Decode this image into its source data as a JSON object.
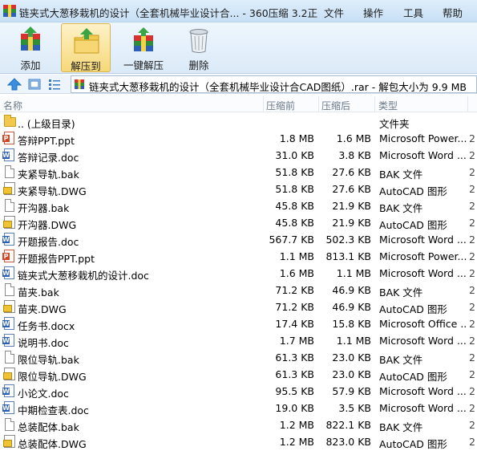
{
  "window": {
    "title": "链夹式大葱移栽机的设计（全套机械毕业设计合... - 360压缩 3.2正式版",
    "menu": [
      "文件",
      "操作",
      "工具",
      "帮助"
    ]
  },
  "toolbar": {
    "buttons": [
      {
        "label": "添加",
        "icon": "add-archive-icon"
      },
      {
        "label": "解压到",
        "icon": "extract-to-icon"
      },
      {
        "label": "一键解压",
        "icon": "one-click-extract-icon"
      },
      {
        "label": "删除",
        "icon": "trash-icon"
      }
    ]
  },
  "address": {
    "text": "链夹式大葱移栽机的设计（全套机械毕业设计合CAD图纸）.rar - 解包大小为 9.9 MB"
  },
  "columns": {
    "name": "名称",
    "size": "压缩前",
    "packed": "压缩后",
    "type": "类型"
  },
  "files": [
    {
      "name": ".. (上级目录)",
      "size": "",
      "packed": "",
      "type": "文件夹",
      "icon": "folder-icon"
    },
    {
      "name": "答辩PPT.ppt",
      "size": "1.8 MB",
      "packed": "1.6 MB",
      "type": "Microsoft Power...",
      "icon": "ppt-icon"
    },
    {
      "name": "答辩记录.doc",
      "size": "31.0 KB",
      "packed": "3.8 KB",
      "type": "Microsoft Word ...",
      "icon": "word-icon"
    },
    {
      "name": "夹紧导轨.bak",
      "size": "51.8 KB",
      "packed": "27.6 KB",
      "type": "BAK 文件",
      "icon": "bak-icon"
    },
    {
      "name": "夹紧导轨.DWG",
      "size": "51.8 KB",
      "packed": "27.6 KB",
      "type": "AutoCAD 图形",
      "icon": "dwg-icon"
    },
    {
      "name": "开沟器.bak",
      "size": "45.8 KB",
      "packed": "21.9 KB",
      "type": "BAK 文件",
      "icon": "bak-icon"
    },
    {
      "name": "开沟器.DWG",
      "size": "45.8 KB",
      "packed": "21.9 KB",
      "type": "AutoCAD 图形",
      "icon": "dwg-icon"
    },
    {
      "name": "开题报告.doc",
      "size": "567.7 KB",
      "packed": "502.3 KB",
      "type": "Microsoft Word ...",
      "icon": "word-icon"
    },
    {
      "name": "开题报告PPT.ppt",
      "size": "1.1 MB",
      "packed": "813.1 KB",
      "type": "Microsoft Power...",
      "icon": "ppt-icon"
    },
    {
      "name": "链夹式大葱移栽机的设计.doc",
      "size": "1.6 MB",
      "packed": "1.1 MB",
      "type": "Microsoft Word ...",
      "icon": "word-icon"
    },
    {
      "name": "苗夹.bak",
      "size": "71.2 KB",
      "packed": "46.9 KB",
      "type": "BAK 文件",
      "icon": "bak-icon"
    },
    {
      "name": "苗夹.DWG",
      "size": "71.2 KB",
      "packed": "46.9 KB",
      "type": "AutoCAD 图形",
      "icon": "dwg-icon"
    },
    {
      "name": "任务书.docx",
      "size": "17.4 KB",
      "packed": "15.8 KB",
      "type": "Microsoft Office ...",
      "icon": "word-icon"
    },
    {
      "name": "说明书.doc",
      "size": "1.7 MB",
      "packed": "1.1 MB",
      "type": "Microsoft Word ...",
      "icon": "word-icon"
    },
    {
      "name": "限位导轨.bak",
      "size": "61.3 KB",
      "packed": "23.0 KB",
      "type": "BAK 文件",
      "icon": "bak-icon"
    },
    {
      "name": "限位导轨.DWG",
      "size": "61.3 KB",
      "packed": "23.0 KB",
      "type": "AutoCAD 图形",
      "icon": "dwg-icon"
    },
    {
      "name": "小论文.doc",
      "size": "95.5 KB",
      "packed": "57.9 KB",
      "type": "Microsoft Word ...",
      "icon": "word-icon"
    },
    {
      "name": "中期检查表.doc",
      "size": "19.0 KB",
      "packed": "3.5 KB",
      "type": "Microsoft Word ...",
      "icon": "word-icon"
    },
    {
      "name": "总装配体.bak",
      "size": "1.2 MB",
      "packed": "822.1 KB",
      "type": "BAK 文件",
      "icon": "bak-icon"
    },
    {
      "name": "总装配体.DWG",
      "size": "1.2 MB",
      "packed": "823.0 KB",
      "type": "AutoCAD 图形",
      "icon": "dwg-icon"
    }
  ],
  "tail_glyph": "2"
}
